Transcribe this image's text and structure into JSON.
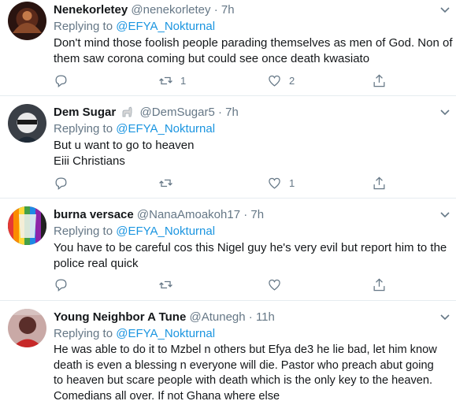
{
  "tweets": [
    {
      "name": "Nenekorletey",
      "handle": "@nenekorletey",
      "time": "7h",
      "replying_prefix": "Replying to ",
      "replying_to": "@EFYA_Nokturnal",
      "lines": [
        "Don't mind those foolish people parading themselves as men of God. Non of",
        "them saw corona coming but could see once death kwasiato"
      ],
      "replies": "",
      "retweets": "1",
      "likes": "2"
    },
    {
      "name": "Dem Sugar",
      "handle": "@DemSugar5",
      "time": "7h",
      "replying_prefix": "Replying to ",
      "replying_to": "@EFYA_Nokturnal",
      "lines": [
        "But u want to go to heaven",
        "Eiii Christians"
      ],
      "replies": "",
      "retweets": "",
      "likes": "1"
    },
    {
      "name": "burna versace",
      "handle": "@NanaAmoakoh17",
      "time": "7h",
      "replying_prefix": "Replying to ",
      "replying_to": "@EFYA_Nokturnal",
      "lines": [
        "You have to be careful cos this Nigel guy he's very evil but report him to the",
        "police real quick"
      ],
      "replies": "",
      "retweets": "",
      "likes": ""
    },
    {
      "name": "Young Neighbor A Tune",
      "handle": "@Atunegh",
      "time": "11h",
      "replying_prefix": "Replying to ",
      "replying_to": "@EFYA_Nokturnal",
      "lines": [
        "He was able to do it to Mzbel n others but Efya de3 he lie bad, let him know",
        "death is even a blessing n everyone will die. Pastor who preach abut going",
        "to heaven but scare people with death which is the only key to the heaven.",
        "Comedians all over. If not Ghana where else"
      ],
      "replies": "",
      "retweets": "",
      "likes": ""
    }
  ],
  "separator": "·",
  "colors": {
    "link": "#1b95e0",
    "muted": "#657786",
    "text": "#14171a",
    "border": "#e6ecf0"
  }
}
